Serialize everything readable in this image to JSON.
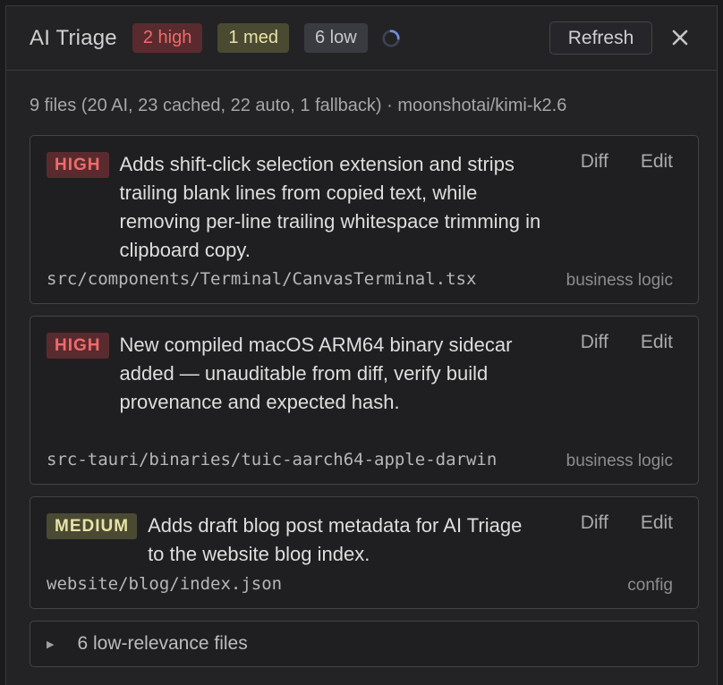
{
  "header": {
    "title": "AI Triage",
    "badges": {
      "high": "2 high",
      "med": "1 med",
      "low": "6 low"
    },
    "refresh_label": "Refresh",
    "close_icon": "close-icon",
    "spinner_icon": "loading-spinner-icon"
  },
  "summary": "9 files (20 AI, 23 cached, 22 auto, 1 fallback) · moonshotai/kimi-k2.6",
  "cards": [
    {
      "severity": "HIGH",
      "description": "Adds shift-click selection extension and strips trailing blank lines from copied text, while removing per-line trailing whitespace trimming in clipboard copy.",
      "path": "src/components/Terminal/CanvasTerminal.tsx",
      "category": "business logic",
      "diff_label": "Diff",
      "edit_label": "Edit"
    },
    {
      "severity": "HIGH",
      "description": "New compiled macOS ARM64 binary sidecar added — unauditable from diff, verify build provenance and expected hash.",
      "path": "src-tauri/binaries/tuic-aarch64-apple-darwin",
      "category": "business logic",
      "diff_label": "Diff",
      "edit_label": "Edit"
    },
    {
      "severity": "MEDIUM",
      "description": "Adds draft blog post metadata for AI Triage to the website blog index.",
      "path": "website/blog/index.json",
      "category": "config",
      "diff_label": "Diff",
      "edit_label": "Edit"
    }
  ],
  "low_group": {
    "label": "6 low-relevance files",
    "caret_icon": "caret-right-icon"
  },
  "colors": {
    "high": "#ef6b6b",
    "medium": "#e7e3a6",
    "background": "#232325"
  }
}
